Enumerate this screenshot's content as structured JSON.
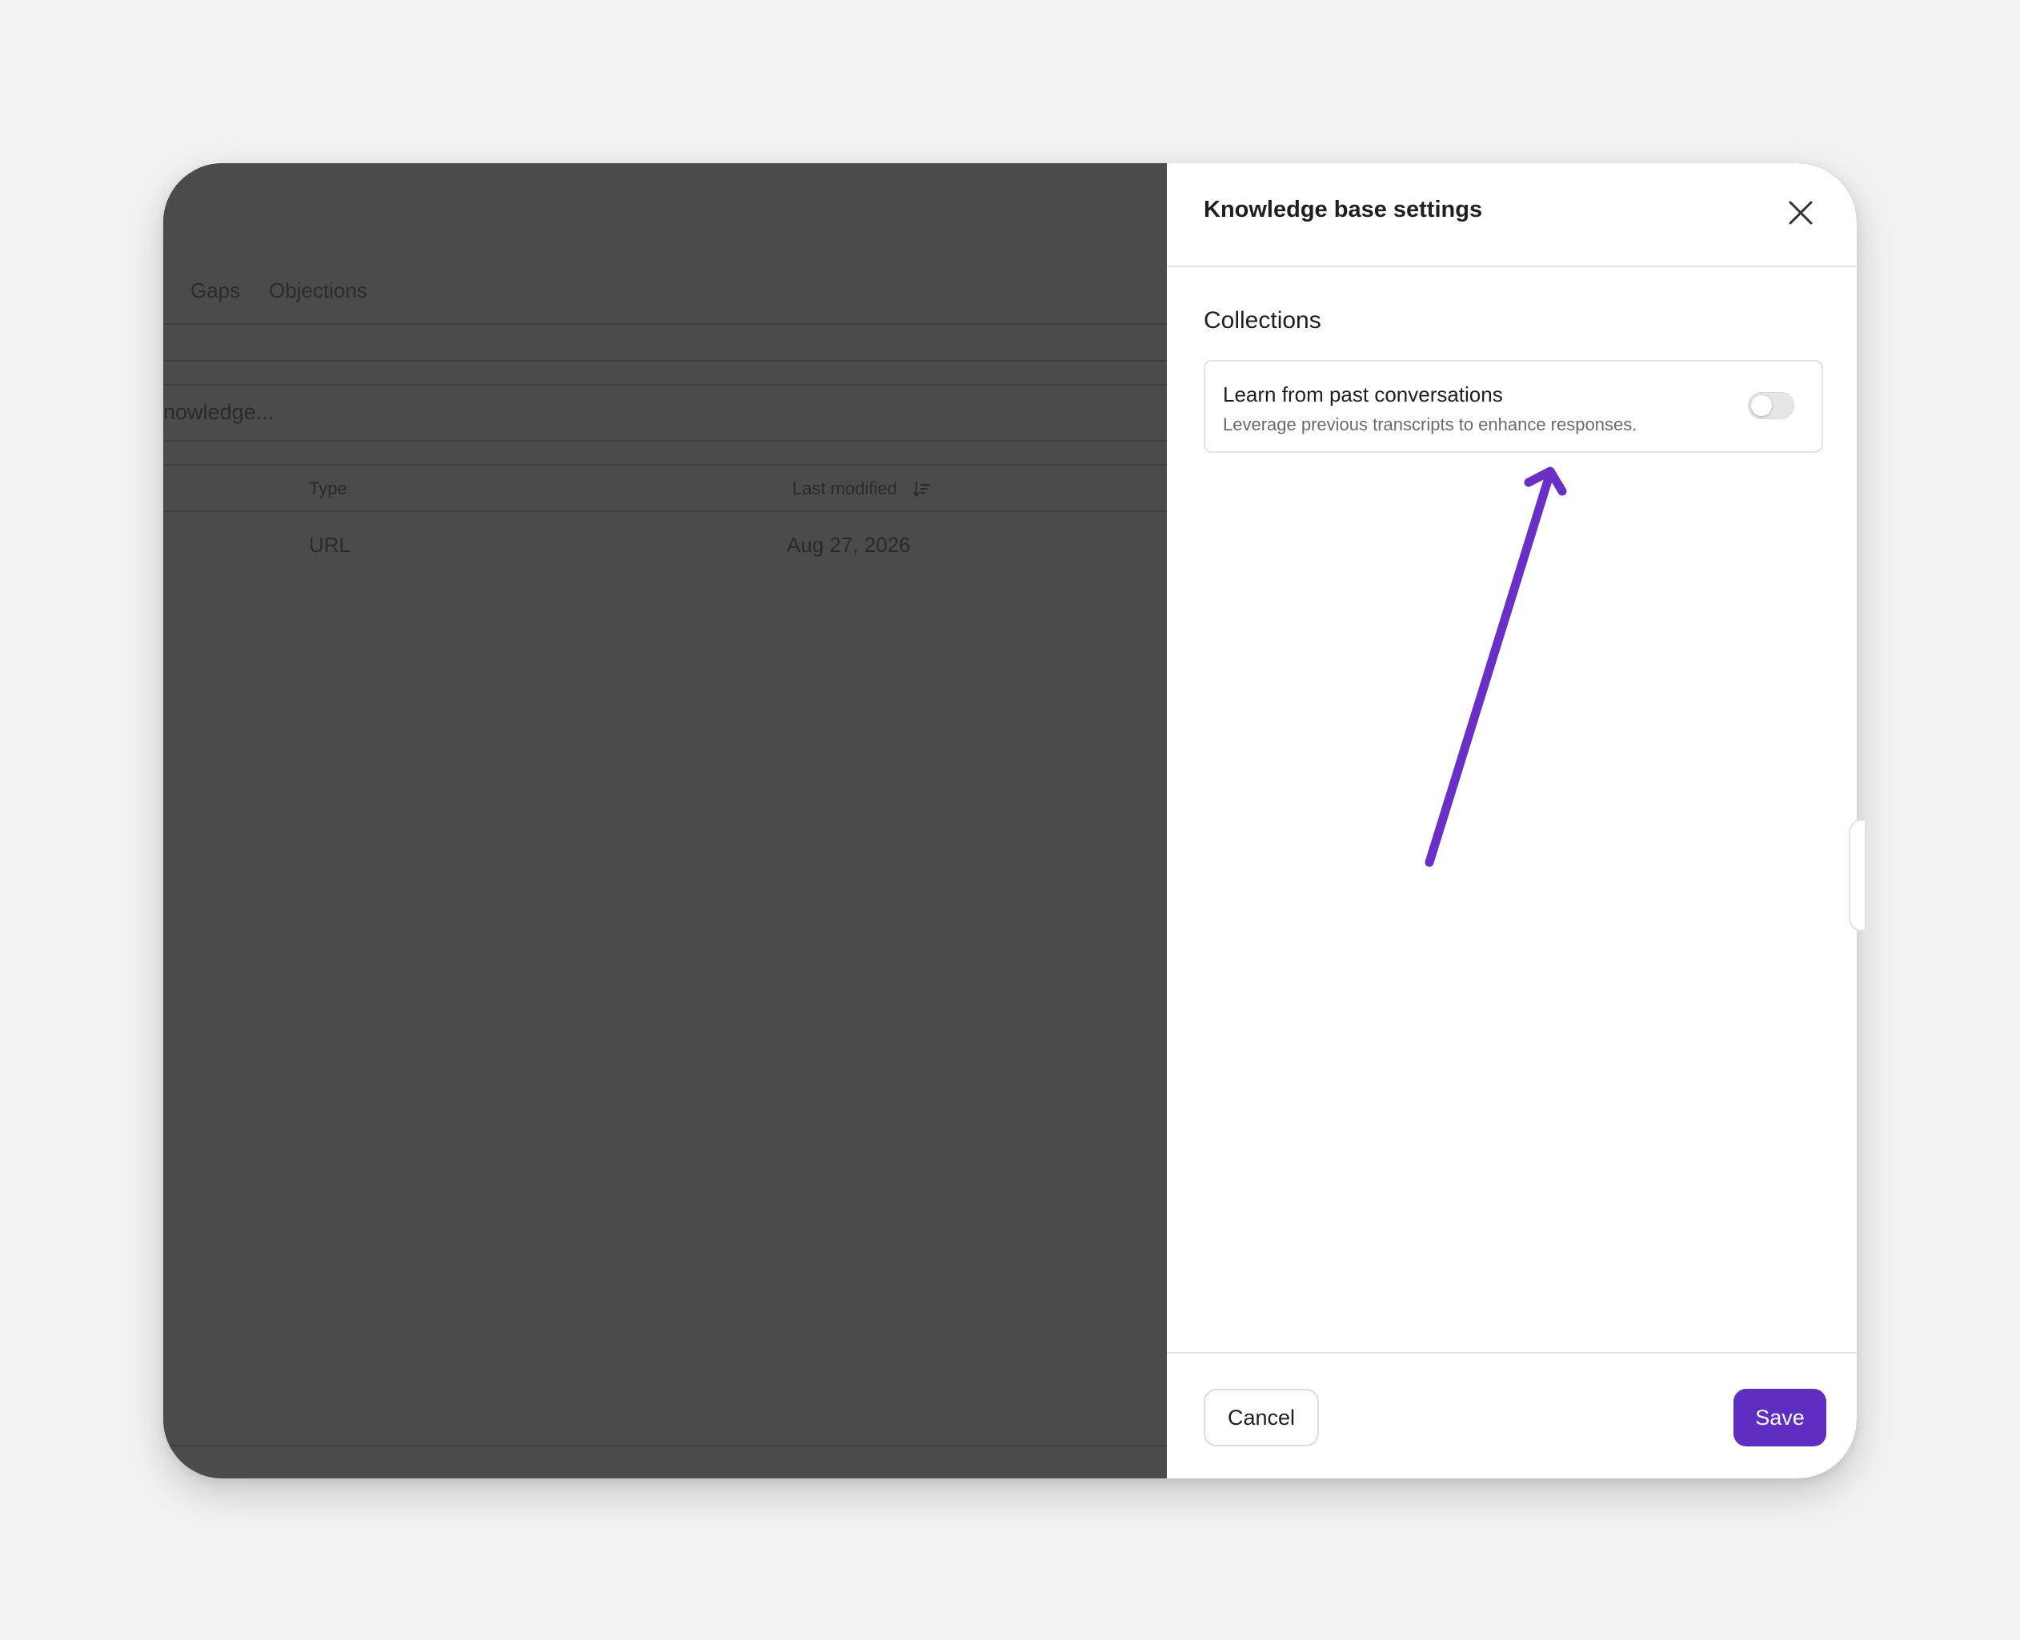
{
  "background_app": {
    "tabs": [
      "Gaps",
      "Objections"
    ],
    "search_placeholder_fragment": "nowledge...",
    "table": {
      "columns": [
        {
          "label": "Type"
        },
        {
          "label": "Last modified",
          "sort_icon": "sort-descending-icon"
        }
      ],
      "rows": [
        {
          "type": "URL",
          "last_modified": "Aug 27, 2026"
        }
      ]
    }
  },
  "drawer": {
    "title": "Knowledge base settings",
    "close_icon": "close-icon",
    "section_title": "Collections",
    "setting": {
      "label": "Learn from past conversations",
      "description": "Leverage previous transcripts to enhance responses.",
      "enabled": false
    },
    "footer": {
      "cancel_label": "Cancel",
      "save_label": "Save"
    }
  },
  "colors": {
    "accent": "#5e2ec2",
    "annotation_arrow": "#6a2fc6",
    "overlay": "#4b4b4b"
  }
}
